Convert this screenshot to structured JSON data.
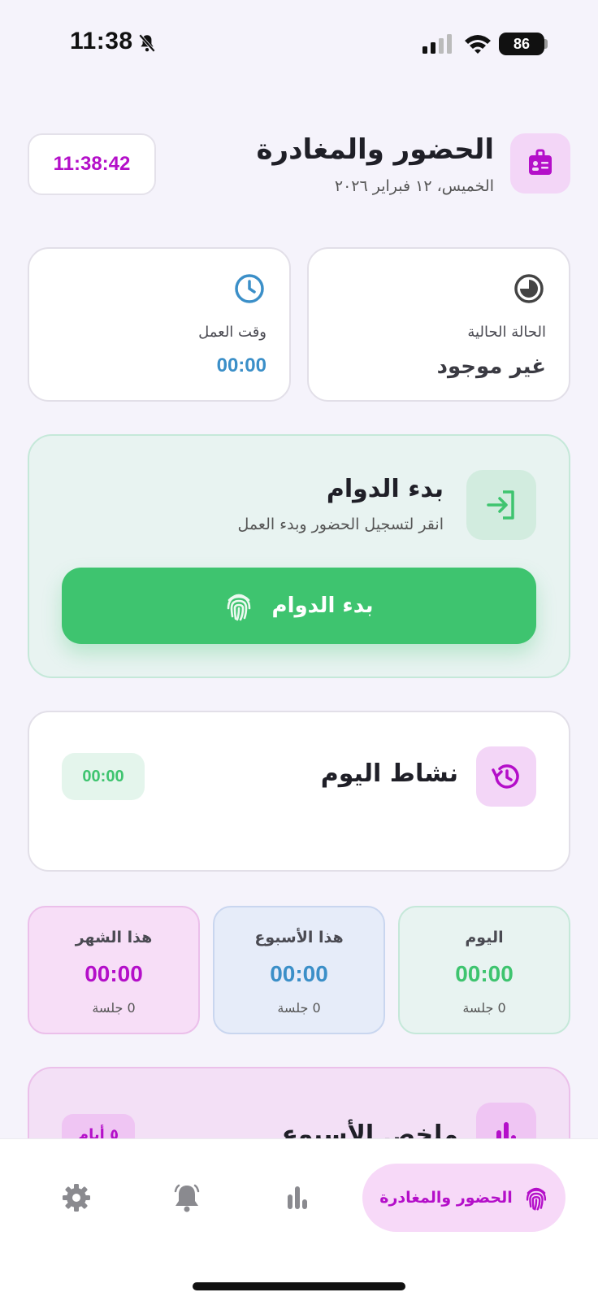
{
  "status_bar": {
    "time": "11:38",
    "battery": "86"
  },
  "header": {
    "title": "الحضور والمغادرة",
    "date": "الخميس، ١٢ فبراير ٢٠٢٦",
    "clock": "11:38:42"
  },
  "cards": {
    "status": {
      "label": "الحالة الحالية",
      "value": "غير موجود"
    },
    "work_time": {
      "label": "وقت العمل",
      "value": "00:00"
    }
  },
  "start_shift": {
    "title": "بدء الدوام",
    "subtitle": "انقر لتسجيل الحضور وبدء العمل",
    "button_label": "بدء الدوام"
  },
  "activity": {
    "title": "نشاط اليوم",
    "time": "00:00"
  },
  "periods": {
    "today": {
      "label": "اليوم",
      "value": "00:00",
      "sessions": "0 جلسة"
    },
    "week": {
      "label": "هذا الأسبوع",
      "value": "00:00",
      "sessions": "0 جلسة"
    },
    "month": {
      "label": "هذا الشهر",
      "value": "00:00",
      "sessions": "0 جلسة"
    }
  },
  "weekly_summary": {
    "title": "ملخص الأسبوع",
    "days": "٥ أيام"
  },
  "bottom_nav": {
    "active_label": "الحضور والمغادرة"
  },
  "colors": {
    "accent_purple": "#b40fc9",
    "green": "#3ec46f",
    "blue": "#3b8fc8"
  }
}
